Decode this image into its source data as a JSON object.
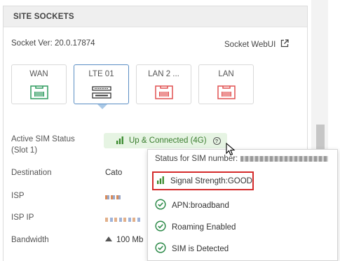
{
  "panel": {
    "title": "SITE SOCKETS",
    "socket_version_label": "Socket Ver: 20.0.17874",
    "webui_label": "Socket WebUI"
  },
  "ports": [
    {
      "label": "WAN",
      "color": "#2e9b5f",
      "active": false
    },
    {
      "label": "LTE 01",
      "color": "#333333",
      "active": true
    },
    {
      "label": "LAN 2 ...",
      "color": "#e15050",
      "active": false
    },
    {
      "label": "LAN",
      "color": "#e15050",
      "active": false
    }
  ],
  "details": {
    "sim_status_label": "Active SIM Status",
    "sim_slot_label": "(Slot 1)",
    "sim_status_value": "Up & Connected (4G)",
    "destination_label": "Destination",
    "destination_value": "Cato",
    "isp_label": "ISP",
    "isp_ip_label": "ISP IP",
    "bandwidth_label": "Bandwidth",
    "bandwidth_value": "100 Mb"
  },
  "popup": {
    "title": "Status for SIM number:",
    "items": [
      {
        "label": "Signal Strength:GOOD",
        "icon": "signal-bars-icon"
      },
      {
        "label": "APN:broadband",
        "icon": "check-circle-icon"
      },
      {
        "label": "Roaming Enabled",
        "icon": "check-circle-icon"
      },
      {
        "label": "SIM is Detected",
        "icon": "check-circle-icon"
      }
    ]
  },
  "colors": {
    "accent": "#5a8ec4",
    "success": "#2e9b5f",
    "warning": "#d42b2b",
    "status_bg": "#e6f4e3"
  }
}
